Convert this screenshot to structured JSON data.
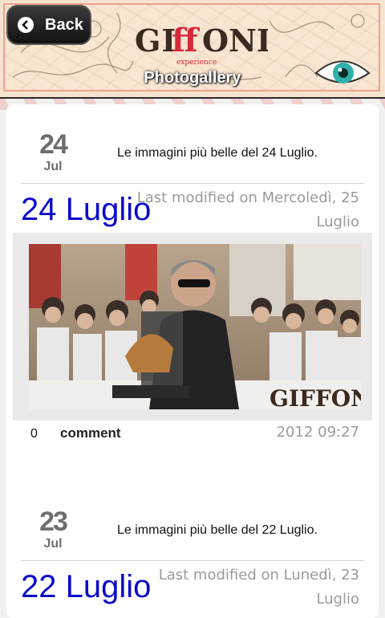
{
  "header": {
    "back_label": "Back",
    "title": "Photogallery",
    "logo": {
      "text_left": "GI",
      "text_ff": "ff",
      "text_right": "ONI",
      "tagline": "experience"
    }
  },
  "posts": [
    {
      "day": "24",
      "month": "Jul",
      "summary": "Le immagini più belle del 24 Luglio.",
      "title": "24 Luglio",
      "modified_line1": "Last modified on Mercoledì, 25",
      "modified_line2": "Luglio",
      "modified_line3": "2012 09:27",
      "comment_count": "0",
      "comment_label": "comment"
    },
    {
      "day": "23",
      "month": "Jul",
      "summary": "Le immagini più belle del 22 Luglio.",
      "title": "22 Luglio",
      "modified_line1": "Last modified on Lunedì, 23",
      "modified_line2": "Luglio"
    }
  ],
  "colors": {
    "header_bg": "#f6e3cf",
    "title_link": "#0b0bcc",
    "muted_text": "#9a9a9a",
    "date_text": "#6e6e6e"
  },
  "icons": {
    "back": "chevron-left-icon",
    "eye": "eye-icon"
  }
}
